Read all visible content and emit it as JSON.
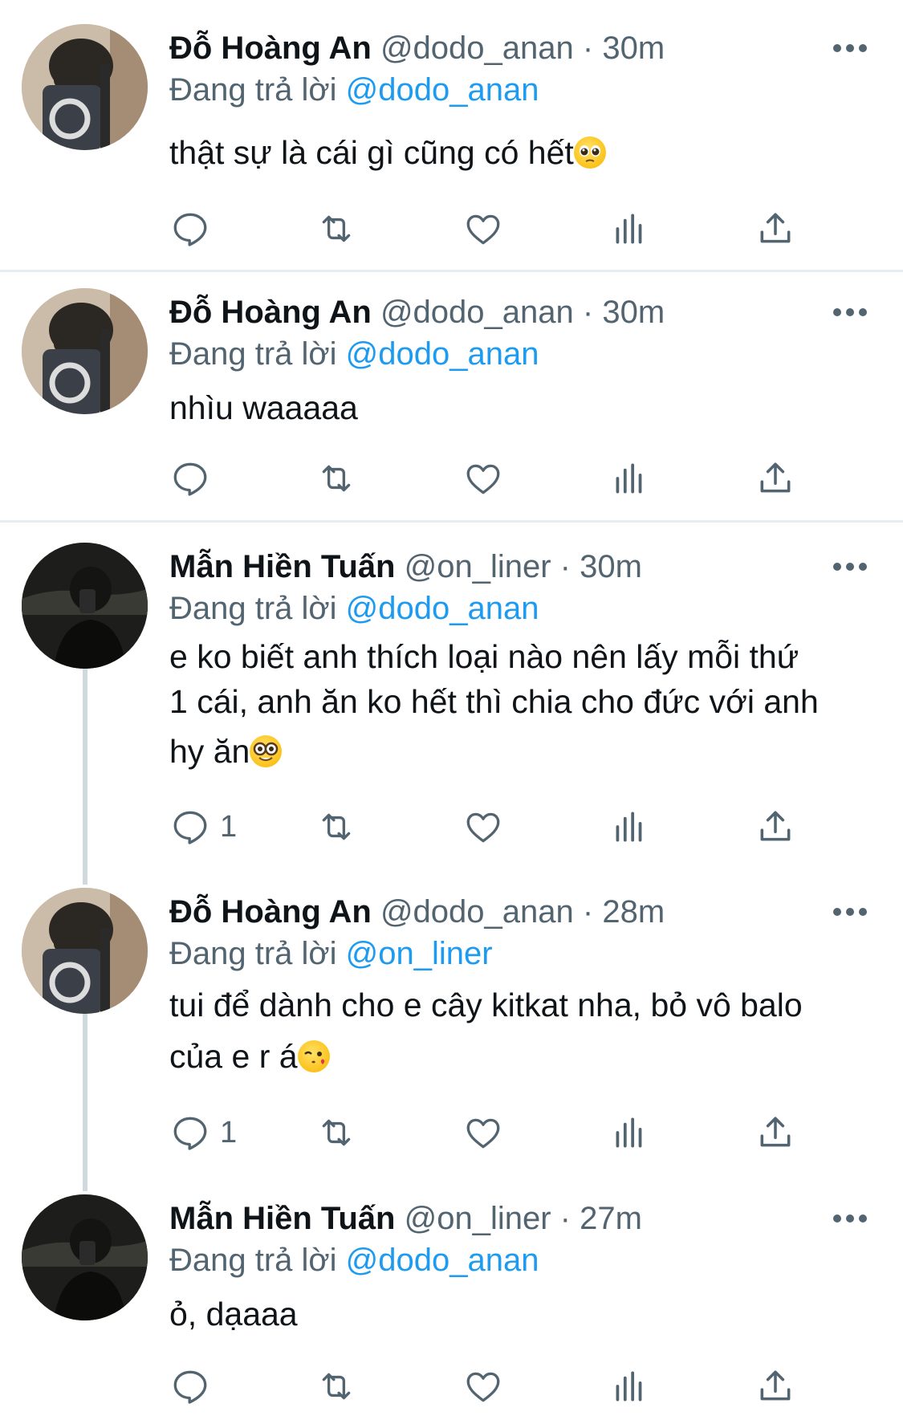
{
  "tweets": [
    {
      "name": "Đỗ Hoàng An",
      "handle": "@dodo_anan",
      "time": "30m",
      "reply_prefix": "Đang trả lời",
      "reply_to": "@dodo_anan",
      "lines": [
        "thật sự là cái gì cũng có hết"
      ],
      "emoji": "pleading-face",
      "reply_count": "",
      "avatar": "light"
    },
    {
      "name": "Đỗ Hoàng An",
      "handle": "@dodo_anan",
      "time": "30m",
      "reply_prefix": "Đang trả lời",
      "reply_to": "@dodo_anan",
      "lines": [
        "nhìu waaaaa"
      ],
      "emoji": "",
      "reply_count": "",
      "avatar": "light"
    },
    {
      "name": "Mẫn Hiền Tuấn",
      "handle": "@on_liner",
      "time": "30m",
      "reply_prefix": "Đang trả lời",
      "reply_to": "@dodo_anan",
      "lines": [
        "e ko biết anh thích loại nào nên lấy mỗi thứ",
        "1 cái, anh ăn ko hết thì chia cho đức với anh",
        "hy ăn"
      ],
      "emoji": "nerd-face",
      "reply_count": "1",
      "avatar": "dark"
    },
    {
      "name": "Đỗ Hoàng An",
      "handle": "@dodo_anan",
      "time": "28m",
      "reply_prefix": "Đang trả lời",
      "reply_to": "@on_liner",
      "lines": [
        "tui để dành cho e cây kitkat nha, bỏ vô balo",
        "của e r á"
      ],
      "emoji": "face-blowing-a-kiss",
      "reply_count": "1",
      "avatar": "light"
    },
    {
      "name": "Mẫn Hiền Tuấn",
      "handle": "@on_liner",
      "time": "27m",
      "reply_prefix": "Đang trả lời",
      "reply_to": "@dodo_anan",
      "lines": [
        "ỏ, dạaaa"
      ],
      "emoji": "",
      "reply_count": "",
      "avatar": "dark"
    }
  ],
  "separator": " · ",
  "icons": {
    "more": "more-horizontal-icon",
    "reply": "reply-icon",
    "retweet": "retweet-icon",
    "like": "like-icon",
    "views": "views-icon",
    "share": "share-icon"
  },
  "colors": {
    "text": "#0f1419",
    "secondary": "#536471",
    "accent": "#1d9bf0",
    "divider": "#e6ecf0",
    "thread_line": "#cfd9de"
  }
}
